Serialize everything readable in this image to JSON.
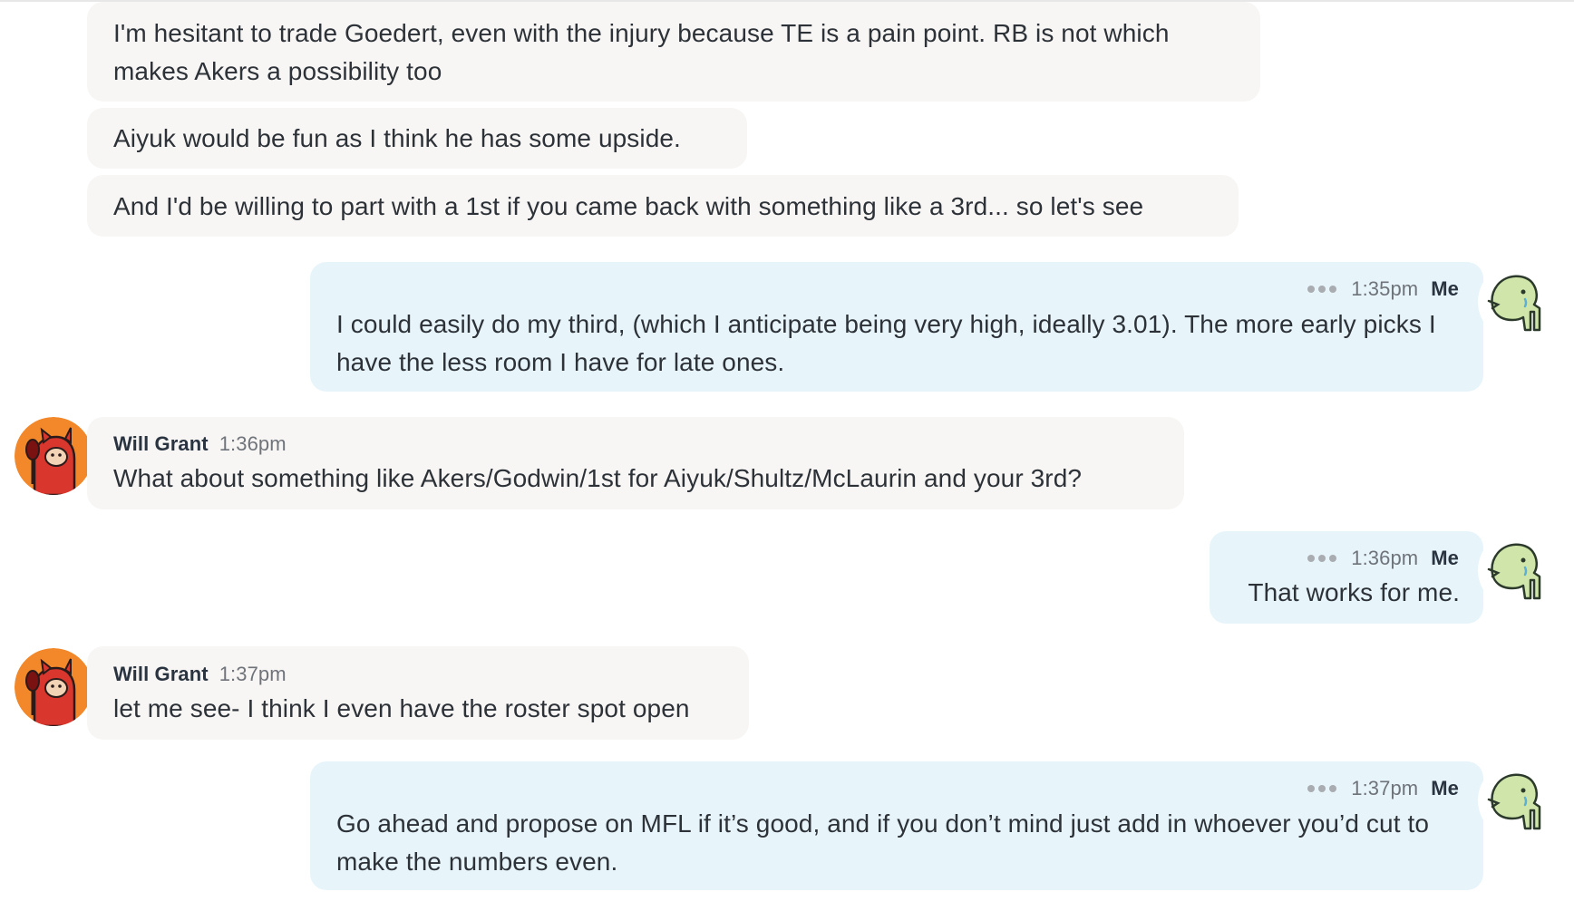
{
  "conversation": {
    "messages": [
      {
        "sender": "Will Grant",
        "text": "I'm hesitant to trade Goedert, even with the injury because TE is a pain point. RB is not which makes Akers a possibility too"
      },
      {
        "sender": "Will Grant",
        "text": "Aiyuk would be fun as I think he has some upside."
      },
      {
        "sender": "Will Grant",
        "text": "And I'd be willing to part with a 1st if you came back with something like a 3rd... so let's see"
      },
      {
        "sender": "Me",
        "time": "1:35pm",
        "text": "I could easily do my third, (which I anticipate being very high, ideally 3.01). The more early picks I have the less room I have for late ones."
      },
      {
        "sender": "Will Grant",
        "time": "1:36pm",
        "text": "What about something like Akers/Godwin/1st for Aiyuk/Shultz/McLaurin and your 3rd?"
      },
      {
        "sender": "Me",
        "time": "1:36pm",
        "text": "That works for me."
      },
      {
        "sender": "Will Grant",
        "time": "1:37pm",
        "text": "let me see- I think I even have the roster spot open"
      },
      {
        "sender": "Me",
        "time": "1:37pm",
        "text": "Go ahead and propose on MFL if it’s good, and if you don’t mind just add in whoever you’d cut to make the numbers even."
      }
    ]
  },
  "colors": {
    "their_bubble": "#f7f6f4",
    "my_bubble": "#e7f5fb",
    "text": "#2d3238",
    "meta": "#6f737a"
  },
  "icons": {
    "my_avatar": "green-elephant-icon",
    "their_avatar": "red-devil-cat-icon",
    "more_actions": "ellipsis-icon"
  }
}
